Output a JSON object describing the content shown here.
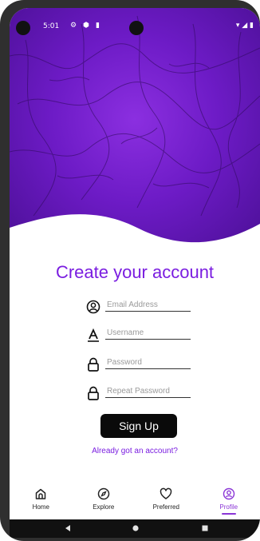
{
  "status_bar": {
    "time": "5:01",
    "icons": [
      "gear-icon",
      "shield-icon",
      "sim-icon"
    ],
    "right_icons": [
      "wifi-icon",
      "signal-icon",
      "battery-icon"
    ]
  },
  "title": "Create your account",
  "form": {
    "email": {
      "placeholder": "Email Address",
      "icon": "user-circle-icon"
    },
    "username": {
      "placeholder": "Username",
      "icon": "text-a-icon"
    },
    "password": {
      "placeholder": "Password",
      "icon": "lock-icon"
    },
    "repeat_password": {
      "placeholder": "Repeat Password",
      "icon": "lock-icon"
    }
  },
  "buttons": {
    "sign_up": "Sign Up"
  },
  "links": {
    "login": "Already got an account?"
  },
  "bottom_nav": {
    "items": [
      {
        "label": "Home",
        "icon": "home-icon"
      },
      {
        "label": "Explore",
        "icon": "compass-icon"
      },
      {
        "label": "Preferred",
        "icon": "heart-icon"
      },
      {
        "label": "Profile",
        "icon": "profile-icon"
      }
    ],
    "active_index": 3
  },
  "colors": {
    "accent": "#7a1de0",
    "hero_purple": "#6d1bc6",
    "button_black": "#0a0a0a"
  }
}
